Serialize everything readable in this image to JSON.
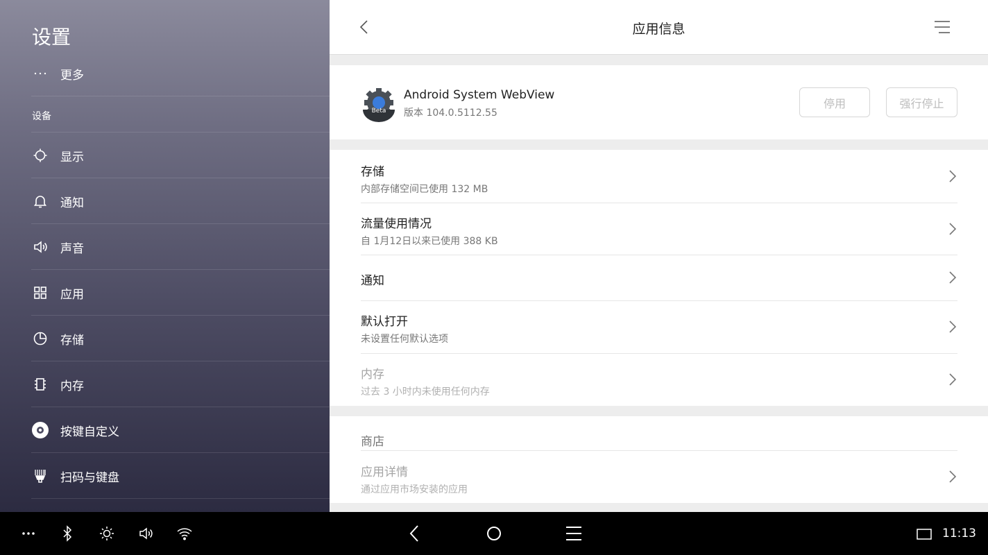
{
  "sidebar": {
    "title": "设置",
    "more_label": "更多",
    "section_device": "设备",
    "items": [
      {
        "label": "显示",
        "icon": "display-icon"
      },
      {
        "label": "通知",
        "icon": "bell-icon"
      },
      {
        "label": "声音",
        "icon": "speaker-icon"
      },
      {
        "label": "应用",
        "icon": "apps-grid-icon"
      },
      {
        "label": "存储",
        "icon": "pie-chart-icon"
      },
      {
        "label": "内存",
        "icon": "memory-chip-icon"
      },
      {
        "label": "按键自定义",
        "icon": "key-custom-icon"
      },
      {
        "label": "扫码与键盘",
        "icon": "scanner-icon"
      }
    ]
  },
  "header": {
    "title": "应用信息"
  },
  "app": {
    "name": "Android System WebView",
    "version": "版本 104.0.5112.55",
    "icon_badge": "Beta",
    "disable_label": "停用",
    "force_stop_label": "强行停止"
  },
  "details": [
    {
      "title": "存储",
      "subtitle": "内部存储空间已使用 132 MB"
    },
    {
      "title": "流量使用情况",
      "subtitle": "自 1月12日以来已使用 388 KB"
    },
    {
      "title": "通知",
      "subtitle": ""
    },
    {
      "title": "默认打开",
      "subtitle": "未设置任何默认选项"
    },
    {
      "title": "内存",
      "subtitle": "过去 3 小时内未使用任何内存"
    }
  ],
  "store": {
    "header": "商店",
    "item_title": "应用详情",
    "item_subtitle": "通过应用市场安装的应用"
  },
  "navbar": {
    "time": "11:13"
  },
  "colors": {
    "sidebar_top": "#8b8a9c",
    "sidebar_bottom": "#2c2b41",
    "navbar_bg": "#000000",
    "panel_bg": "#ededed"
  }
}
